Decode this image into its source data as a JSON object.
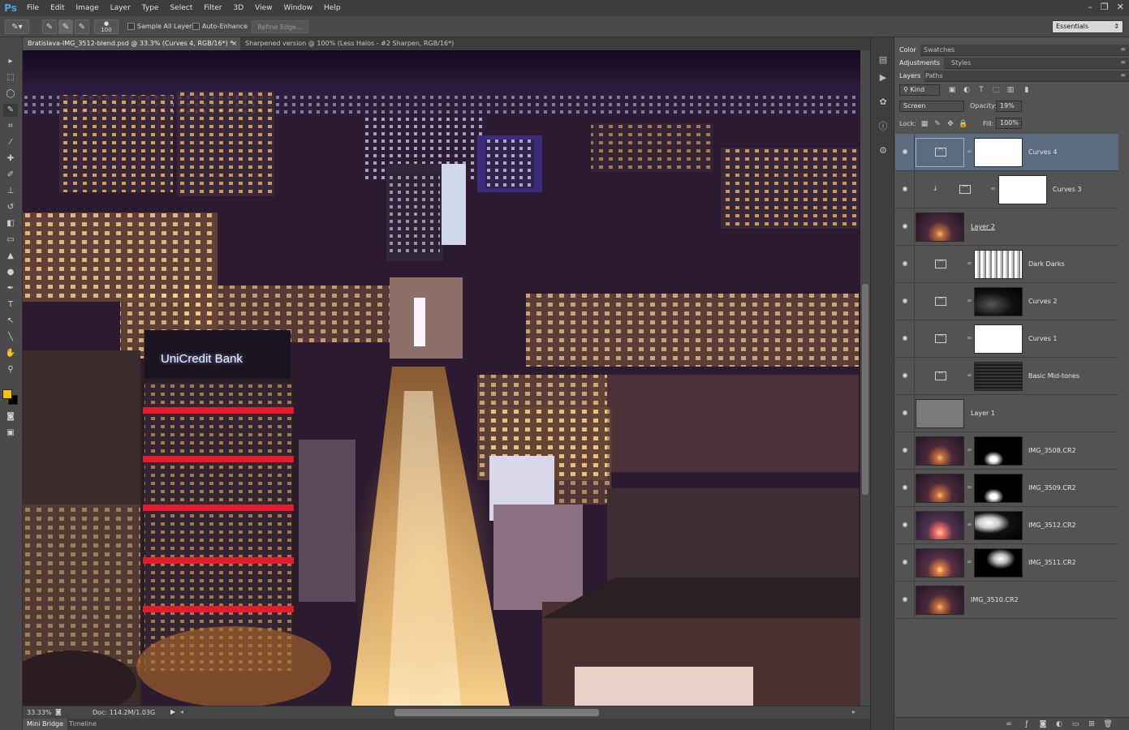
{
  "app": {
    "logo": "Ps"
  },
  "menu": [
    "File",
    "Edit",
    "Image",
    "Layer",
    "Type",
    "Select",
    "Filter",
    "3D",
    "View",
    "Window",
    "Help"
  ],
  "window_controls": {
    "minimize": "–",
    "restore": "❐",
    "close": "✕"
  },
  "options_bar": {
    "brush_size": "100",
    "sample_all_layers": "Sample All Layers",
    "auto_enhance": "Auto-Enhance",
    "refine_edge": "Refine Edge...",
    "workspace": "Essentials"
  },
  "document_tabs": [
    {
      "label": "Bratislava-IMG_3512-blend.psd @ 33.3% (Curves 4, RGB/16*) *",
      "close": "×",
      "active": true
    },
    {
      "label": "Sharpened version @ 100% (Less Halos - #2 Sharpen, RGB/16*) *",
      "close": "×",
      "active": false
    }
  ],
  "canvas": {
    "sign_text": "UniCredit Bank"
  },
  "status": {
    "zoom": "33.33%",
    "doc_info": "Doc: 114.2M/1.03G"
  },
  "bottom_tabs": [
    "Mini Bridge",
    "Timeline"
  ],
  "panels": {
    "group1_tabs": [
      "Color",
      "Swatches"
    ],
    "group2_tabs": [
      "Adjustments",
      "Styles"
    ],
    "group3_tabs": [
      "Layers",
      "Paths"
    ],
    "filter_kind": "Kind",
    "blend_mode": "Screen",
    "opacity_label": "Opacity:",
    "opacity_value": "19%",
    "lock_label": "Lock:",
    "fill_label": "Fill:",
    "fill_value": "100%"
  },
  "layers": [
    {
      "name": "Curves 4",
      "type": "adjustment",
      "selected": true
    },
    {
      "name": "Curves 3",
      "type": "adjustment-clipped",
      "selected": false
    },
    {
      "name": "Layer 2",
      "type": "pixel",
      "selected": false
    },
    {
      "name": "Dark Darks",
      "type": "adjustment",
      "selected": false
    },
    {
      "name": "Curves 2",
      "type": "adjustment",
      "selected": false
    },
    {
      "name": "Curves 1",
      "type": "adjustment",
      "selected": false
    },
    {
      "name": "Basic Mid-tones",
      "type": "adjustment",
      "selected": false
    },
    {
      "name": "Layer 1",
      "type": "pixel",
      "selected": false
    },
    {
      "name": "IMG_3508.CR2",
      "type": "masked",
      "selected": false
    },
    {
      "name": "IMG_3509.CR2",
      "type": "masked",
      "selected": false
    },
    {
      "name": "IMG_3512.CR2",
      "type": "masked",
      "selected": false
    },
    {
      "name": "IMG_3511.CR2",
      "type": "masked",
      "selected": false
    },
    {
      "name": "IMG_3510.CR2",
      "type": "pixel",
      "selected": false
    }
  ],
  "colors": {
    "foreground": "#f5c400",
    "background": "#000000",
    "selected_row": "#5b6b80"
  }
}
